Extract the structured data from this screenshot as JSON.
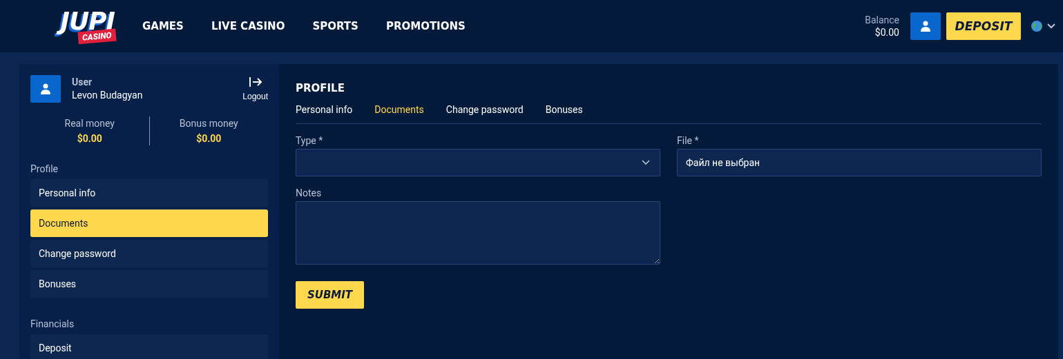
{
  "header": {
    "logo": {
      "word": "JUPI",
      "badge": "CASINO"
    },
    "nav": [
      {
        "label": "GAMES"
      },
      {
        "label": "LIVE CASINO"
      },
      {
        "label": "SPORTS"
      },
      {
        "label": "PROMOTIONS"
      }
    ],
    "balance": {
      "label": "Balance",
      "amount": "$0.00"
    },
    "deposit_button": "DEPOSIT"
  },
  "sidebar": {
    "user": {
      "role": "User",
      "name": "Levon Budagyan"
    },
    "logout": "Logout",
    "wallets": [
      {
        "label": "Real money",
        "amount": "$0.00"
      },
      {
        "label": "Bonus money",
        "amount": "$0.00"
      }
    ],
    "sections": [
      {
        "title": "Profile",
        "items": [
          {
            "label": "Personal info",
            "selected": false
          },
          {
            "label": "Documents",
            "selected": true
          },
          {
            "label": "Change password",
            "selected": false
          },
          {
            "label": "Bonuses",
            "selected": false
          }
        ]
      },
      {
        "title": "Financials",
        "items": [
          {
            "label": "Deposit",
            "selected": false
          }
        ]
      }
    ]
  },
  "main": {
    "title": "PROFILE",
    "tabs": [
      {
        "label": "Personal info",
        "selected": false
      },
      {
        "label": "Documents",
        "selected": true
      },
      {
        "label": "Change password",
        "selected": false
      },
      {
        "label": "Bonuses",
        "selected": false
      }
    ],
    "type_label": "Type *",
    "file_label": "File *",
    "file_value": "Файл не выбран",
    "notes_label": "Notes",
    "submit": "SUBMIT"
  }
}
